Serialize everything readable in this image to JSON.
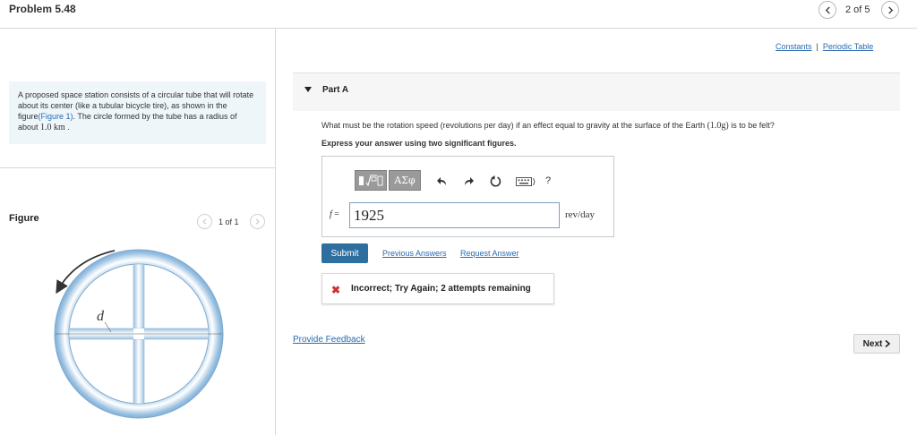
{
  "header": {
    "title": "Problem 5.48",
    "pager": "2 of 5",
    "prev_icon": "chevron-left-icon",
    "next_icon": "chevron-right-icon"
  },
  "intro": {
    "text_before": "A proposed space station consists of a circular tube that will rotate about its center (like a tubular bicycle tire), as shown in the figure",
    "figure_link": "(Figure 1)",
    "text_after": ". The circle formed by the tube has a radius of about ",
    "radius_value": "1.0 km",
    "text_end": " ."
  },
  "figure": {
    "label": "Figure",
    "count": "1 of 1",
    "diagram_label": "d"
  },
  "links": {
    "constants": "Constants",
    "separator": "|",
    "periodic_table": "Periodic Table"
  },
  "part": {
    "title": "Part A",
    "question_before": "What must be the rotation speed (revolutions per day) if an effect equal to gravity at the surface of the Earth ",
    "question_math": "(1.0g)",
    "question_after": " is to be felt?",
    "instruction": "Express your answer using two significant figures."
  },
  "toolbar": {
    "template_icon": "fraction-sqrt-template-icon",
    "greek_label": "ΑΣφ",
    "undo_icon": "undo-icon",
    "redo_icon": "redo-icon",
    "reset_icon": "reset-icon",
    "keyboard_icon": "keyboard-icon",
    "help_label": "?"
  },
  "answer": {
    "variable": "f",
    "equals": " =",
    "value": "1925",
    "unit": "rev/day"
  },
  "actions": {
    "submit": "Submit",
    "previous_answers": "Previous Answers",
    "request_answer": "Request Answer"
  },
  "feedback": {
    "icon": "x-mark-icon",
    "text": "Incorrect; Try Again; 2 attempts remaining"
  },
  "footer": {
    "provide_feedback": "Provide Feedback",
    "next": "Next"
  },
  "colors": {
    "link": "#2a6bb0",
    "submit_bg": "#2f6f9f",
    "intro_bg": "#eef6fa",
    "error": "#d0312d"
  }
}
